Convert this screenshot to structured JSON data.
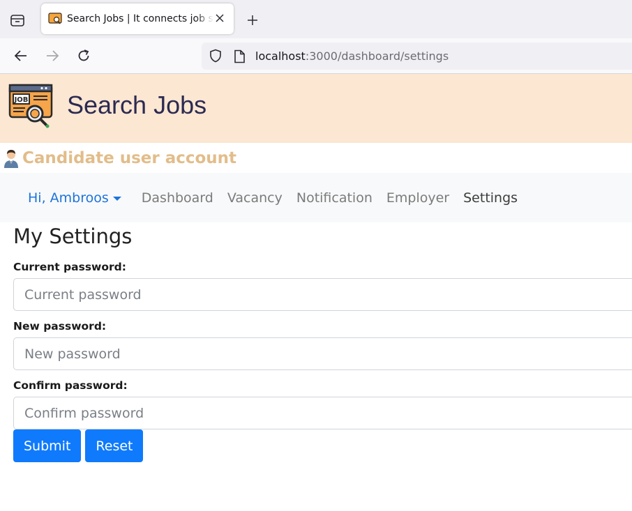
{
  "browser": {
    "tab_title": "Search Jobs | It connects job seekers",
    "url_host": "localhost",
    "url_path": ":3000/dashboard/settings"
  },
  "header": {
    "site_title": "Search Jobs"
  },
  "account": {
    "label": "Candidate user account"
  },
  "nav": {
    "user_menu": "Hi, Ambroos",
    "items": [
      {
        "label": "Dashboard"
      },
      {
        "label": "Vacancy"
      },
      {
        "label": "Notification"
      },
      {
        "label": "Employer"
      },
      {
        "label": "Settings"
      }
    ]
  },
  "settings": {
    "heading": "My Settings",
    "current_label": "Current password:",
    "current_placeholder": "Current password",
    "new_label": "New password:",
    "new_placeholder": "New password",
    "confirm_label": "Confirm password:",
    "confirm_placeholder": "Confirm password",
    "submit_label": "Submit",
    "reset_label": "Reset"
  },
  "colors": {
    "header_bg": "#fbe7d2",
    "account_label": "#e2bd8a",
    "link_blue": "#1d73dc",
    "button_blue": "#0f7afc"
  }
}
